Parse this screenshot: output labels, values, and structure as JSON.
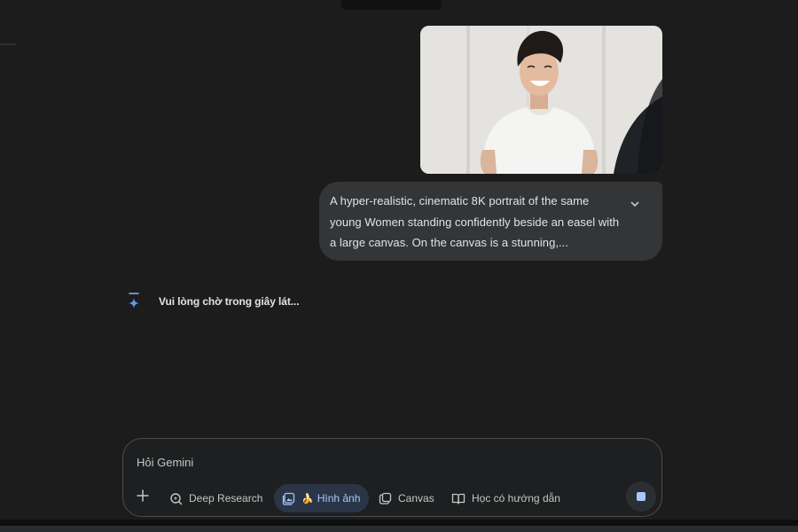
{
  "conversation": {
    "user_image": {
      "alt": "portrait photo"
    },
    "prompt": {
      "lines": [
        "A hyper-realistic, cinematic 8K portrait of the same",
        "young Women standing confidently beside an easel with",
        "a large canvas. On the canvas is a stunning,..."
      ],
      "expand_icon": "chevron-down-icon"
    },
    "response": {
      "icon": "gemini-spark-icon",
      "status": "Vui lòng chờ trong giây lát..."
    }
  },
  "composer": {
    "placeholder": "Hỏi Gemini",
    "add_icon": "plus-icon",
    "tools": [
      {
        "label": "Deep Research",
        "icon": "deep-research-icon"
      },
      {
        "label": "Hình ảnh",
        "icon": "image-icon",
        "emoji": "🍌",
        "active": true
      },
      {
        "label": "Canvas",
        "icon": "canvas-icon"
      },
      {
        "label": "Học có hướng dẫn",
        "icon": "guided-learning-icon"
      }
    ],
    "stop_icon": "stop-icon"
  },
  "colors": {
    "background": "#1c1c1d",
    "bubble": "#333537",
    "accent": "#a8c7fa",
    "active_chip": "#2a3548"
  }
}
